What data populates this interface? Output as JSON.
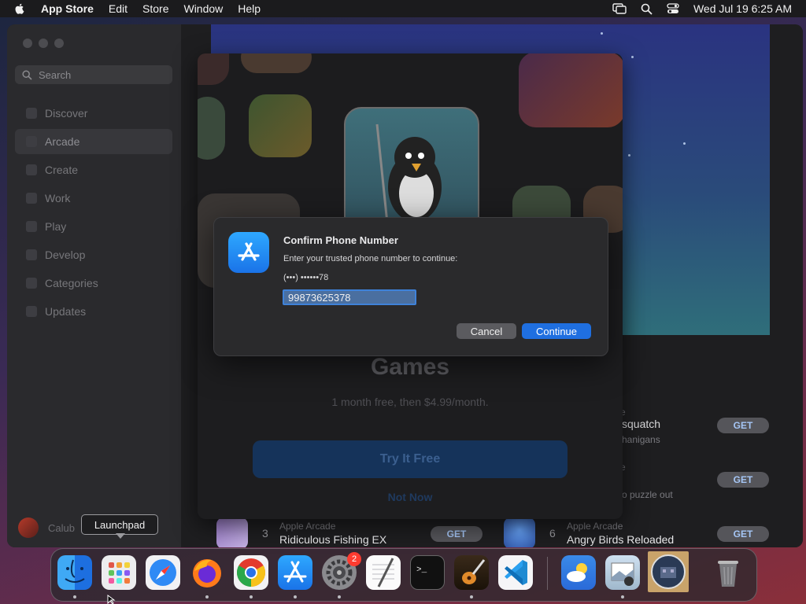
{
  "menubar": {
    "app_name": "App Store",
    "menus": [
      "Edit",
      "Store",
      "Window",
      "Help"
    ],
    "clock": "Wed Jul 19  6:25 AM"
  },
  "sidebar": {
    "search_placeholder": "Search",
    "items": [
      {
        "label": "Discover",
        "icon": "star-icon"
      },
      {
        "label": "Arcade",
        "icon": "joystick-icon"
      },
      {
        "label": "Create",
        "icon": "brush-icon"
      },
      {
        "label": "Work",
        "icon": "paperplane-icon"
      },
      {
        "label": "Play",
        "icon": "rocket-icon"
      },
      {
        "label": "Develop",
        "icon": "hammer-icon"
      },
      {
        "label": "Categories",
        "icon": "grid-icon"
      },
      {
        "label": "Updates",
        "icon": "download-icon"
      }
    ],
    "active_item": "Arcade",
    "user_name": "Calub"
  },
  "sheet": {
    "games_title": "Games",
    "subtitle": "1 month free, then $4.99/month.",
    "try_button": "Try It Free",
    "not_now": "Not Now"
  },
  "list": [
    {
      "rank": "3",
      "subtitle": "Apple Arcade",
      "title": "Ridiculous Fishing EX",
      "button": "GET"
    },
    {
      "rank": "6",
      "subtitle": "Apple Arcade",
      "title": "Angry Birds Reloaded",
      "button": "GET"
    }
  ],
  "right_list": {
    "row1_title": "squatch",
    "row1_sub": "hanigans",
    "row1_button": "GET",
    "row2_sub": "o puzzle out",
    "row2_button": "GET",
    "row3_button": "GET"
  },
  "dialog": {
    "title": "Confirm Phone Number",
    "message": "Enter your trusted phone number to continue:",
    "masked_number": "(•••) ••••••78",
    "input_value": "99873625378",
    "cancel_label": "Cancel",
    "continue_label": "Continue"
  },
  "tooltip": "Launchpad",
  "dock": {
    "apps": [
      "Finder",
      "Launchpad",
      "Safari",
      "Firefox",
      "Chrome",
      "App Store",
      "System Settings",
      "TextEdit",
      "Terminal",
      "GarageBand",
      "Visual Studio Code",
      "Weather",
      "Preview",
      "Network Radar",
      "Trash"
    ],
    "settings_badge": "2"
  },
  "colors": {
    "accent": "#1f6fe0",
    "badge": "#ff3b30",
    "dialog_bg": "#2a2a2c"
  }
}
